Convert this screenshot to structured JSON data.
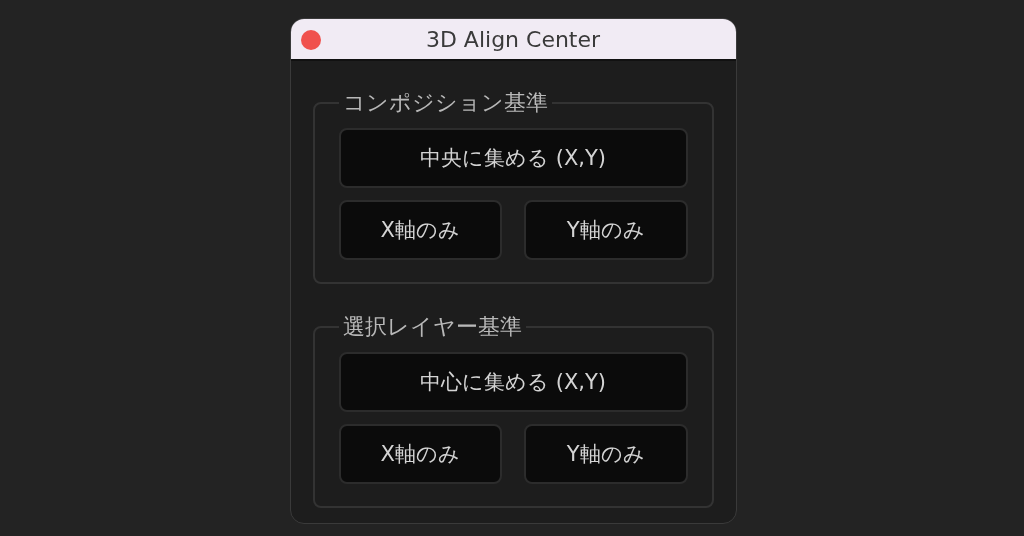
{
  "window": {
    "title": "3D Align Center"
  },
  "groups": [
    {
      "legend": "コンポジション基準",
      "buttons": [
        {
          "label": "中央に集める (X,Y)",
          "kind": "wide"
        },
        {
          "label": "X軸のみ",
          "kind": "half"
        },
        {
          "label": "Y軸のみ",
          "kind": "half"
        }
      ]
    },
    {
      "legend": "選択レイヤー基準",
      "buttons": [
        {
          "label": "中心に集める (X,Y)",
          "kind": "wide"
        },
        {
          "label": "X軸のみ",
          "kind": "half"
        },
        {
          "label": "Y軸のみ",
          "kind": "half"
        }
      ]
    }
  ]
}
